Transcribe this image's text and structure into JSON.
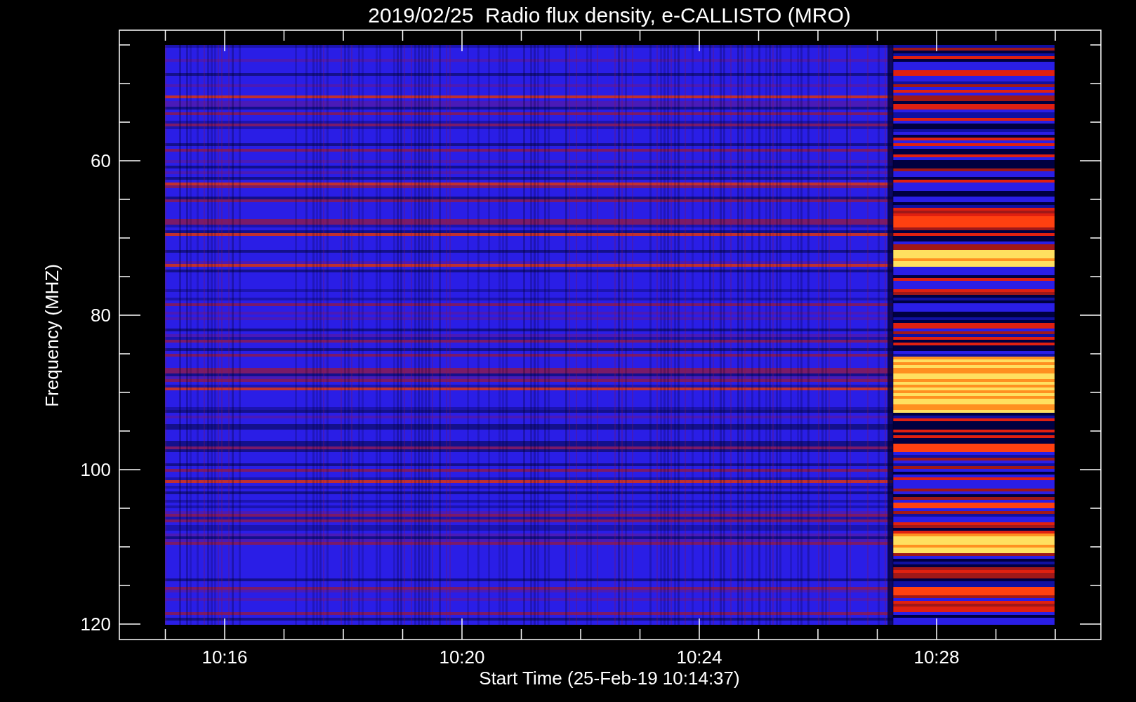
{
  "title": "2019/02/25  Radio flux density, e-CALLISTO (MRO)",
  "x_axis": {
    "label": "Start Time (25-Feb-19 10:14:37)",
    "ticks": [
      "10:16",
      "10:20",
      "10:24",
      "10:28"
    ]
  },
  "y_axis": {
    "label": "Frequency (MHZ)",
    "ticks": [
      "60",
      "80",
      "100",
      "120"
    ]
  }
}
